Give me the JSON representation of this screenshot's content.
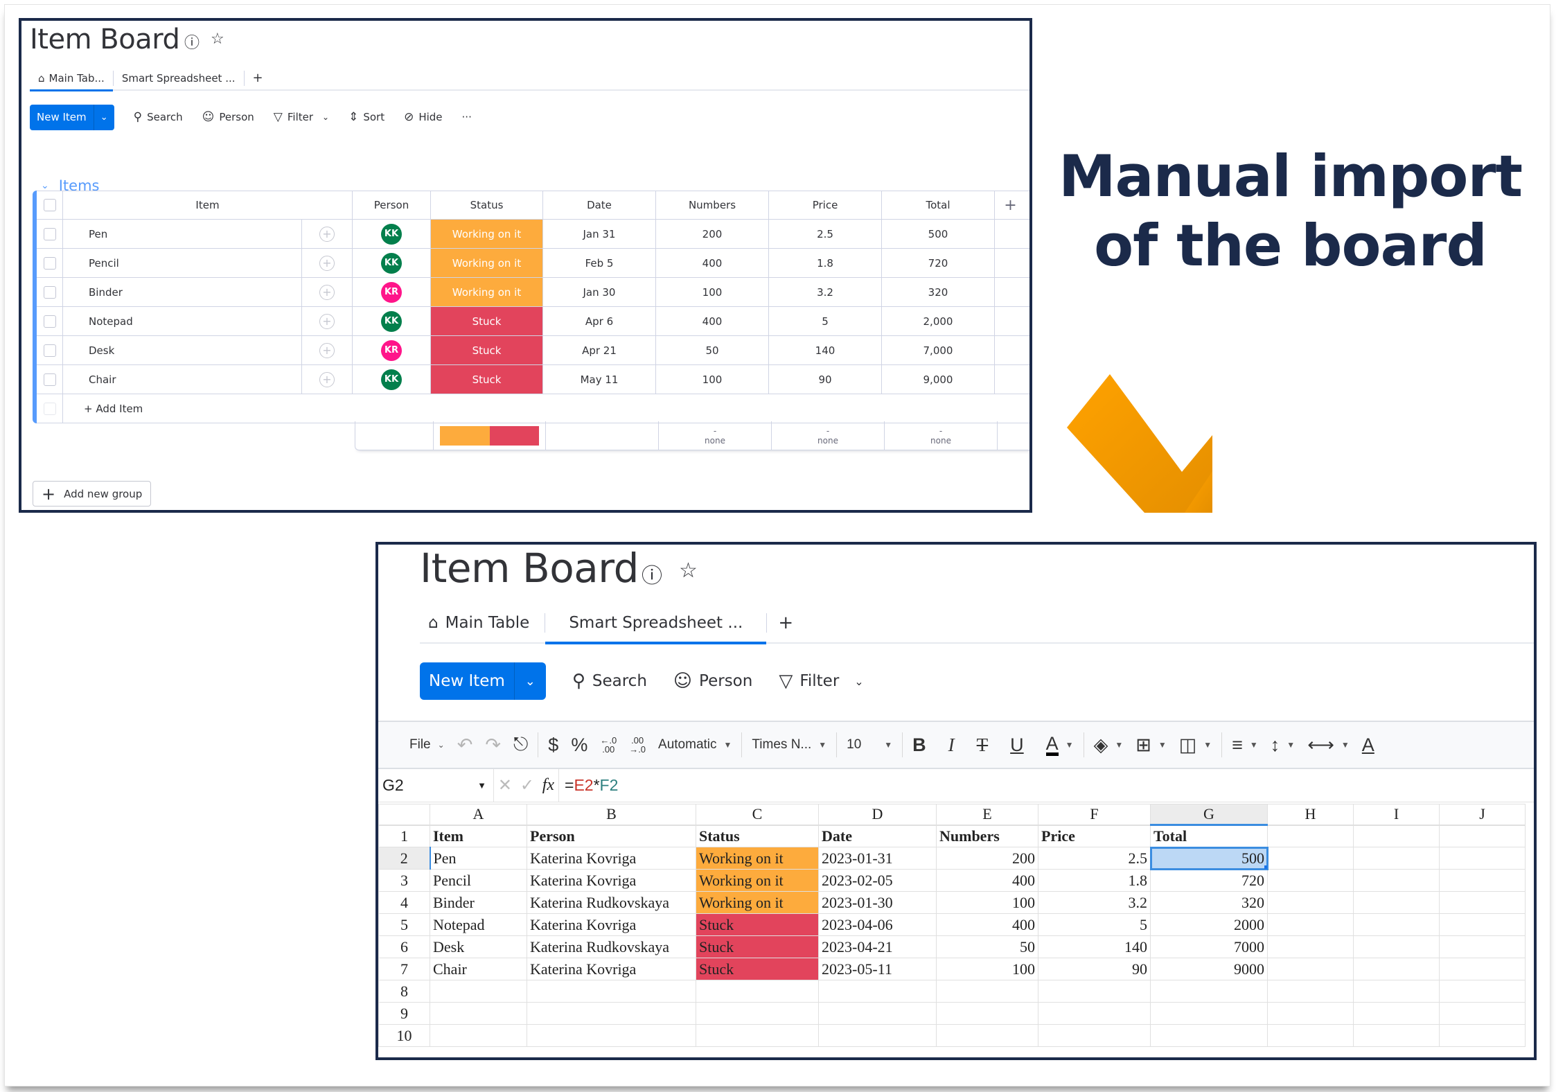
{
  "headline": {
    "line1": "Manual import",
    "line2": "of the board"
  },
  "colors": {
    "brand_blue": "#0073ea",
    "group_blue": "#579bfc",
    "working_on_it": "#fdab3d",
    "stuck": "#e2445c",
    "avatar_kk": "#037f4c",
    "avatar_kr": "#ff158a",
    "frame": "#1b2a4a",
    "arrow_start": "#ffa200",
    "arrow_end": "#e58f00"
  },
  "board_main": {
    "title": "Item Board",
    "info_icon": "info-icon",
    "star_icon": "star-icon",
    "tabs": [
      {
        "label": "Main Tab...",
        "icon": "home-icon",
        "active": true
      },
      {
        "label": "Smart Spreadsheet ...",
        "active": false
      }
    ],
    "add_tab": "+",
    "toolbar": {
      "new_item": "New Item",
      "search": "Search",
      "person": "Person",
      "filter": "Filter",
      "sort": "Sort",
      "hide": "Hide",
      "more": "···"
    },
    "group_name": "Items",
    "columns": [
      "Item",
      "Person",
      "Status",
      "Date",
      "Numbers",
      "Price",
      "Total"
    ],
    "add_column": "+",
    "rows": [
      {
        "item": "Pen",
        "person": "KK",
        "status": "Working on it",
        "date": "Jan 31",
        "numbers": "200",
        "price": "2.5",
        "total": "500"
      },
      {
        "item": "Pencil",
        "person": "KK",
        "status": "Working on it",
        "date": "Feb 5",
        "numbers": "400",
        "price": "1.8",
        "total": "720"
      },
      {
        "item": "Binder",
        "person": "KR",
        "status": "Working on it",
        "date": "Jan 30",
        "numbers": "100",
        "price": "3.2",
        "total": "320"
      },
      {
        "item": "Notepad",
        "person": "KK",
        "status": "Stuck",
        "date": "Apr 6",
        "numbers": "400",
        "price": "5",
        "total": "2,000"
      },
      {
        "item": "Desk",
        "person": "KR",
        "status": "Stuck",
        "date": "Apr 21",
        "numbers": "50",
        "price": "140",
        "total": "7,000"
      },
      {
        "item": "Chair",
        "person": "KK",
        "status": "Stuck",
        "date": "May 11",
        "numbers": "100",
        "price": "90",
        "total": "9,000"
      }
    ],
    "add_item": "+ Add Item",
    "summary": {
      "status_distribution": {
        "working_on_it": 0.5,
        "stuck": 0.5
      },
      "numbers": {
        "value": "-",
        "label": "none"
      },
      "price": {
        "value": "-",
        "label": "none"
      },
      "total": {
        "value": "-",
        "label": "none"
      }
    },
    "add_group": "Add new group"
  },
  "board_sheet": {
    "title": "Item Board",
    "tabs": [
      {
        "label": "Main Table",
        "icon": "home-icon",
        "active": false
      },
      {
        "label": "Smart Spreadsheet ...",
        "active": true
      }
    ],
    "add_tab": "+",
    "toolbar": {
      "new_item": "New Item",
      "search": "Search",
      "person": "Person",
      "filter": "Filter"
    },
    "sheet_toolbar": {
      "file": "File",
      "currency": "$",
      "percent": "%",
      "number_format": "Automatic",
      "font": "Times N...",
      "font_size": "10",
      "bold": "B",
      "italic": "I",
      "underline": "U",
      "text_color": "A"
    },
    "formula_bar": {
      "cell_ref": "G2",
      "formula_prefix": "=",
      "ref1": "E2",
      "op": "*",
      "ref2": "F2"
    },
    "column_letters": [
      "A",
      "B",
      "C",
      "D",
      "E",
      "F",
      "G",
      "H",
      "I",
      "J"
    ],
    "header_row": [
      "Item",
      "Person",
      "Status",
      "Date",
      "Numbers",
      "Price",
      "Total"
    ],
    "rows": [
      {
        "item": "Pen",
        "person": "Katerina Kovriga",
        "status": "Working on it",
        "date": "2023-01-31",
        "numbers": "200",
        "price": "2.5",
        "total": "500"
      },
      {
        "item": "Pencil",
        "person": "Katerina Kovriga",
        "status": "Working on it",
        "date": "2023-02-05",
        "numbers": "400",
        "price": "1.8",
        "total": "720"
      },
      {
        "item": "Binder",
        "person": "Katerina Rudkovskaya",
        "status": "Working on it",
        "date": "2023-01-30",
        "numbers": "100",
        "price": "3.2",
        "total": "320"
      },
      {
        "item": "Notepad",
        "person": "Katerina Kovriga",
        "status": "Stuck",
        "date": "2023-04-06",
        "numbers": "400",
        "price": "5",
        "total": "2000"
      },
      {
        "item": "Desk",
        "person": "Katerina Rudkovskaya",
        "status": "Stuck",
        "date": "2023-04-21",
        "numbers": "50",
        "price": "140",
        "total": "7000"
      },
      {
        "item": "Chair",
        "person": "Katerina Kovriga",
        "status": "Stuck",
        "date": "2023-05-11",
        "numbers": "100",
        "price": "90",
        "total": "9000"
      }
    ],
    "row_numbers": [
      "1",
      "2",
      "3",
      "4",
      "5",
      "6",
      "7",
      "8",
      "9",
      "10"
    ],
    "selected_cell": "G2"
  }
}
